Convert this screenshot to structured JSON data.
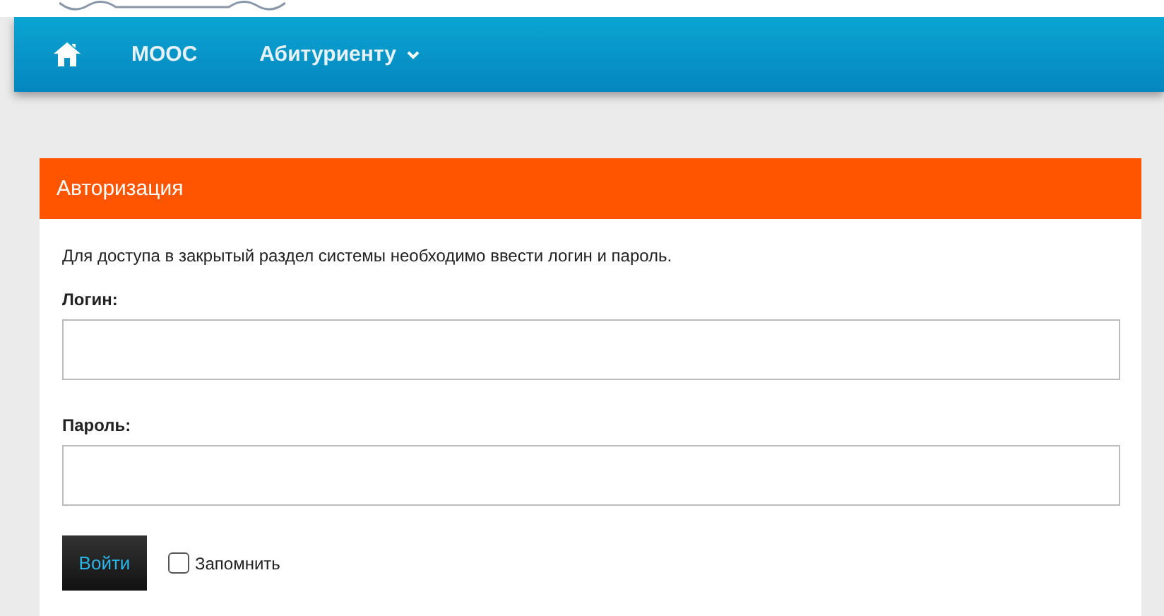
{
  "nav": {
    "items": [
      {
        "kind": "home"
      },
      {
        "kind": "link",
        "label": "МООС"
      },
      {
        "kind": "dropdown",
        "label": "Абитуриенту"
      }
    ]
  },
  "panel": {
    "title": "Авторизация",
    "intro": "Для доступа в закрытый раздел системы необходимо ввести логин и пароль.",
    "fields": [
      {
        "label": "Логин:"
      },
      {
        "label": "Пароль:"
      }
    ],
    "submit": "Войти",
    "remember": {
      "label": "Запомнить",
      "checked": false
    }
  }
}
